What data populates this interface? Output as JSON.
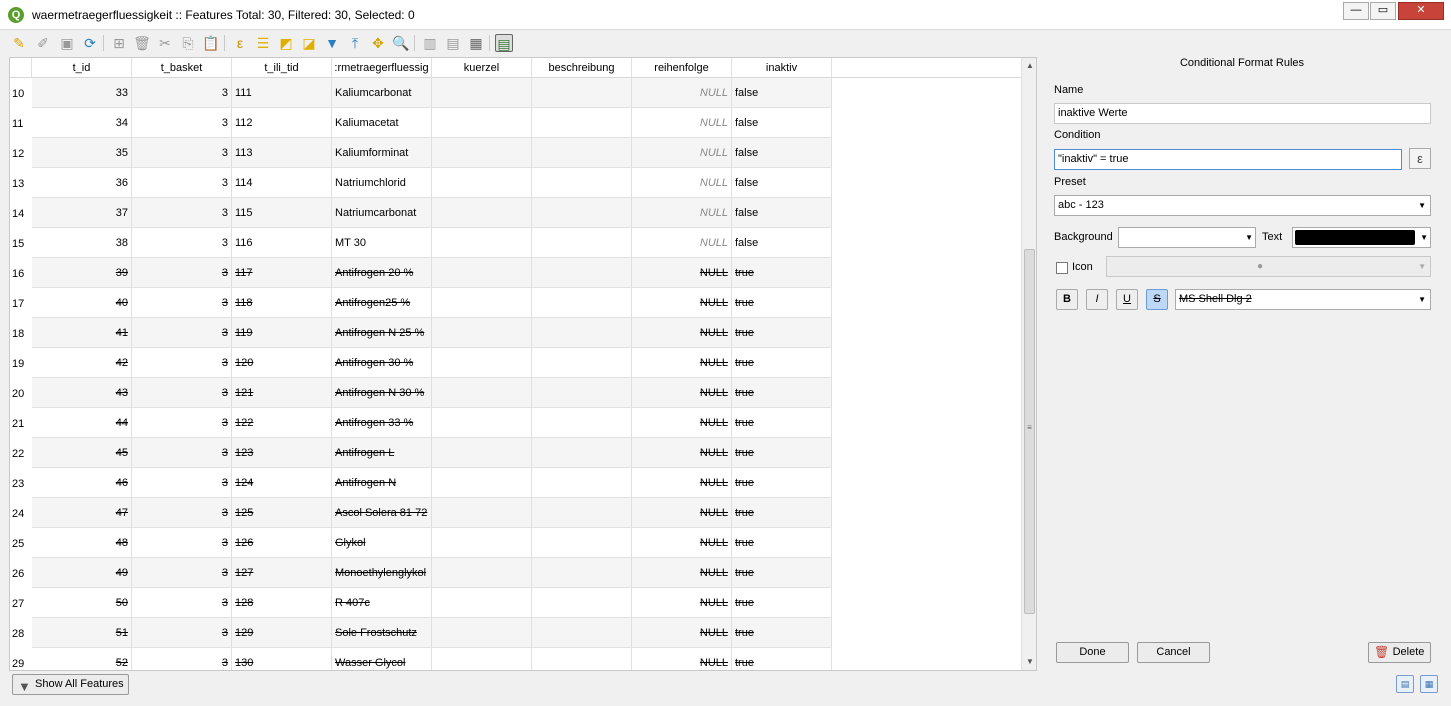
{
  "window": {
    "title": "waermetraegerfluessigkeit :: Features Total: 30, Filtered: 30, Selected: 0",
    "app_icon": "qgis-logo-icon"
  },
  "table": {
    "columns": [
      "t_id",
      "t_basket",
      "t_ili_tid",
      ":rmetraegerfluessig",
      "kuerzel",
      "beschreibung",
      "reihenfolge",
      "inaktiv"
    ],
    "rows": [
      {
        "num": "10",
        "t_id": "33",
        "t_basket": "3",
        "t_ili_tid": "111",
        "name": "Kaliumcarbonat",
        "kuerzel": "",
        "beschreibung": "",
        "reihenfolge": "NULL",
        "inaktiv": "false"
      },
      {
        "num": "11",
        "t_id": "34",
        "t_basket": "3",
        "t_ili_tid": "112",
        "name": "Kaliumacetat",
        "kuerzel": "",
        "beschreibung": "",
        "reihenfolge": "NULL",
        "inaktiv": "false"
      },
      {
        "num": "12",
        "t_id": "35",
        "t_basket": "3",
        "t_ili_tid": "113",
        "name": "Kaliumforminat",
        "kuerzel": "",
        "beschreibung": "",
        "reihenfolge": "NULL",
        "inaktiv": "false"
      },
      {
        "num": "13",
        "t_id": "36",
        "t_basket": "3",
        "t_ili_tid": "114",
        "name": "Natriumchlorid",
        "kuerzel": "",
        "beschreibung": "",
        "reihenfolge": "NULL",
        "inaktiv": "false"
      },
      {
        "num": "14",
        "t_id": "37",
        "t_basket": "3",
        "t_ili_tid": "115",
        "name": "Natriumcarbonat",
        "kuerzel": "",
        "beschreibung": "",
        "reihenfolge": "NULL",
        "inaktiv": "false"
      },
      {
        "num": "15",
        "t_id": "38",
        "t_basket": "3",
        "t_ili_tid": "116",
        "name": "MT 30",
        "kuerzel": "",
        "beschreibung": "",
        "reihenfolge": "NULL",
        "inaktiv": "false"
      },
      {
        "num": "16",
        "t_id": "39",
        "t_basket": "3",
        "t_ili_tid": "117",
        "name": "Antifrogen 20 %",
        "kuerzel": "",
        "beschreibung": "",
        "reihenfolge": "NULL",
        "inaktiv": "true"
      },
      {
        "num": "17",
        "t_id": "40",
        "t_basket": "3",
        "t_ili_tid": "118",
        "name": "Antifrogen25 %",
        "kuerzel": "",
        "beschreibung": "",
        "reihenfolge": "NULL",
        "inaktiv": "true"
      },
      {
        "num": "18",
        "t_id": "41",
        "t_basket": "3",
        "t_ili_tid": "119",
        "name": "Antifrogen N 25 %",
        "kuerzel": "",
        "beschreibung": "",
        "reihenfolge": "NULL",
        "inaktiv": "true"
      },
      {
        "num": "19",
        "t_id": "42",
        "t_basket": "3",
        "t_ili_tid": "120",
        "name": "Antifrogen 30 %",
        "kuerzel": "",
        "beschreibung": "",
        "reihenfolge": "NULL",
        "inaktiv": "true"
      },
      {
        "num": "20",
        "t_id": "43",
        "t_basket": "3",
        "t_ili_tid": "121",
        "name": "Antifrogen N 30 %",
        "kuerzel": "",
        "beschreibung": "",
        "reihenfolge": "NULL",
        "inaktiv": "true"
      },
      {
        "num": "21",
        "t_id": "44",
        "t_basket": "3",
        "t_ili_tid": "122",
        "name": "Antifrogen 33 %",
        "kuerzel": "",
        "beschreibung": "",
        "reihenfolge": "NULL",
        "inaktiv": "true"
      },
      {
        "num": "22",
        "t_id": "45",
        "t_basket": "3",
        "t_ili_tid": "123",
        "name": "Antifrogen L",
        "kuerzel": "",
        "beschreibung": "",
        "reihenfolge": "NULL",
        "inaktiv": "true"
      },
      {
        "num": "23",
        "t_id": "46",
        "t_basket": "3",
        "t_ili_tid": "124",
        "name": "Antifrogen N",
        "kuerzel": "",
        "beschreibung": "",
        "reihenfolge": "NULL",
        "inaktiv": "true"
      },
      {
        "num": "24",
        "t_id": "47",
        "t_basket": "3",
        "t_ili_tid": "125",
        "name": "Ascol Solera 81 72",
        "kuerzel": "",
        "beschreibung": "",
        "reihenfolge": "NULL",
        "inaktiv": "true"
      },
      {
        "num": "25",
        "t_id": "48",
        "t_basket": "3",
        "t_ili_tid": "126",
        "name": "Glykol",
        "kuerzel": "",
        "beschreibung": "",
        "reihenfolge": "NULL",
        "inaktiv": "true"
      },
      {
        "num": "26",
        "t_id": "49",
        "t_basket": "3",
        "t_ili_tid": "127",
        "name": "Monoethylenglykol",
        "kuerzel": "",
        "beschreibung": "",
        "reihenfolge": "NULL",
        "inaktiv": "true"
      },
      {
        "num": "27",
        "t_id": "50",
        "t_basket": "3",
        "t_ili_tid": "128",
        "name": "R 407c",
        "kuerzel": "",
        "beschreibung": "",
        "reihenfolge": "NULL",
        "inaktiv": "true"
      },
      {
        "num": "28",
        "t_id": "51",
        "t_basket": "3",
        "t_ili_tid": "129",
        "name": "Sole Frostschutz",
        "kuerzel": "",
        "beschreibung": "",
        "reihenfolge": "NULL",
        "inaktiv": "true"
      },
      {
        "num": "29",
        "t_id": "52",
        "t_basket": "3",
        "t_ili_tid": "130",
        "name": "Wasser Glycol",
        "kuerzel": "",
        "beschreibung": "",
        "reihenfolge": "NULL",
        "inaktiv": "true"
      }
    ]
  },
  "panel": {
    "title": "Conditional Format Rules",
    "name_label": "Name",
    "name_value": "inaktive Werte",
    "condition_label": "Condition",
    "condition_value": "\"inaktiv\" =  true",
    "expression_button": "ε",
    "preset_label": "Preset",
    "preset_value": "abc - 123",
    "background_label": "Background",
    "background_color": "#ffffff",
    "text_label": "Text",
    "text_color": "#000000",
    "icon_label": "Icon",
    "icon_checked": false,
    "bold": "B",
    "italic": "I",
    "underline": "U",
    "strike": "S",
    "font_value": "MS Shell Dlg 2",
    "done": "Done",
    "cancel": "Cancel",
    "delete": "Delete"
  },
  "footer": {
    "show_all": "Show All Features"
  }
}
